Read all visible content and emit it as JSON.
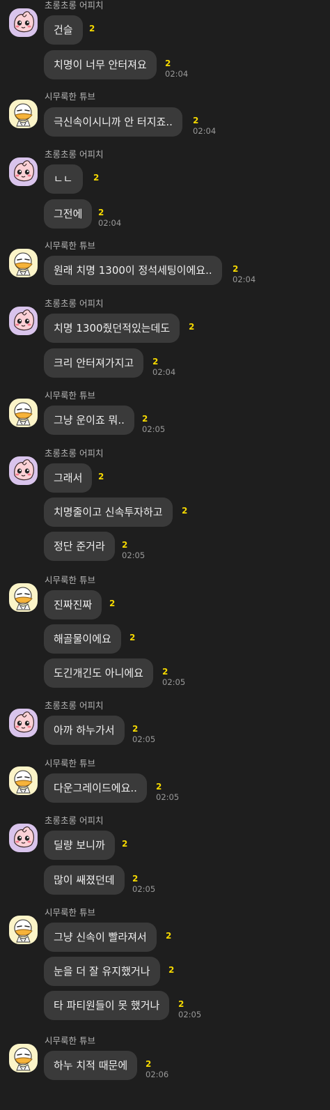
{
  "colors": {
    "background": "#1e1e1e",
    "bubble": "#3a3a3a",
    "unread_count": "#f5d800",
    "sender_name": "#b5b5b5",
    "timestamp": "#9a9a9a"
  },
  "senders": {
    "apeach": {
      "name": "초롱초롱 어피치",
      "avatar_icon": "apeach-avatar-icon"
    },
    "tube": {
      "name": "시무룩한 튜브",
      "avatar_icon": "tube-duck-avatar-icon"
    }
  },
  "groups": [
    {
      "sender": "apeach",
      "messages": [
        {
          "text": "건슬",
          "unread": "2",
          "time": ""
        },
        {
          "text": "치명이 너무 안터져요",
          "unread": "2",
          "time": "02:04"
        }
      ]
    },
    {
      "sender": "tube",
      "messages": [
        {
          "text": "극신속이시니까 안 터지죠..",
          "unread": "2",
          "time": "02:04"
        }
      ]
    },
    {
      "sender": "apeach",
      "messages": [
        {
          "text": "ㄴㄴ",
          "unread": "2",
          "time": ""
        },
        {
          "text": "그전에",
          "unread": "2",
          "time": "02:04"
        }
      ]
    },
    {
      "sender": "tube",
      "messages": [
        {
          "text": "원래 치명 1300이 정석세팅이에요..",
          "unread": "2",
          "time": "02:04"
        }
      ]
    },
    {
      "sender": "apeach",
      "messages": [
        {
          "text": "치명 1300줬던적있는데도",
          "unread": "2",
          "time": ""
        },
        {
          "text": "크리 안터져가지고",
          "unread": "2",
          "time": "02:04"
        }
      ]
    },
    {
      "sender": "tube",
      "messages": [
        {
          "text": "그냥 운이죠 뭐..",
          "unread": "2",
          "time": "02:05"
        }
      ]
    },
    {
      "sender": "apeach",
      "messages": [
        {
          "text": "그래서",
          "unread": "2",
          "time": ""
        },
        {
          "text": "치명줄이고 신속투자하고",
          "unread": "2",
          "time": ""
        },
        {
          "text": "정단 준거라",
          "unread": "2",
          "time": "02:05"
        }
      ]
    },
    {
      "sender": "tube",
      "messages": [
        {
          "text": "진짜진짜",
          "unread": "2",
          "time": ""
        },
        {
          "text": "해골물이에요",
          "unread": "2",
          "time": ""
        },
        {
          "text": "도긴개긴도 아니에요",
          "unread": "2",
          "time": "02:05"
        }
      ]
    },
    {
      "sender": "apeach",
      "messages": [
        {
          "text": "아까 하누가서",
          "unread": "2",
          "time": "02:05"
        }
      ]
    },
    {
      "sender": "tube",
      "messages": [
        {
          "text": "다운그레이드에요..",
          "unread": "2",
          "time": "02:05"
        }
      ]
    },
    {
      "sender": "apeach",
      "messages": [
        {
          "text": "딜량 보니까",
          "unread": "2",
          "time": ""
        },
        {
          "text": "많이 쌔졌던데",
          "unread": "2",
          "time": "02:05"
        }
      ]
    },
    {
      "sender": "tube",
      "messages": [
        {
          "text": "그냥 신속이 빨라져서",
          "unread": "2",
          "time": ""
        },
        {
          "text": "눈을 더 잘 유지했거나",
          "unread": "2",
          "time": ""
        },
        {
          "text": "타 파티원들이 못 했거나",
          "unread": "2",
          "time": "02:05"
        }
      ]
    },
    {
      "sender": "tube",
      "messages": [
        {
          "text": "하누 치적 때문에",
          "unread": "2",
          "time": "02:06"
        }
      ]
    }
  ]
}
